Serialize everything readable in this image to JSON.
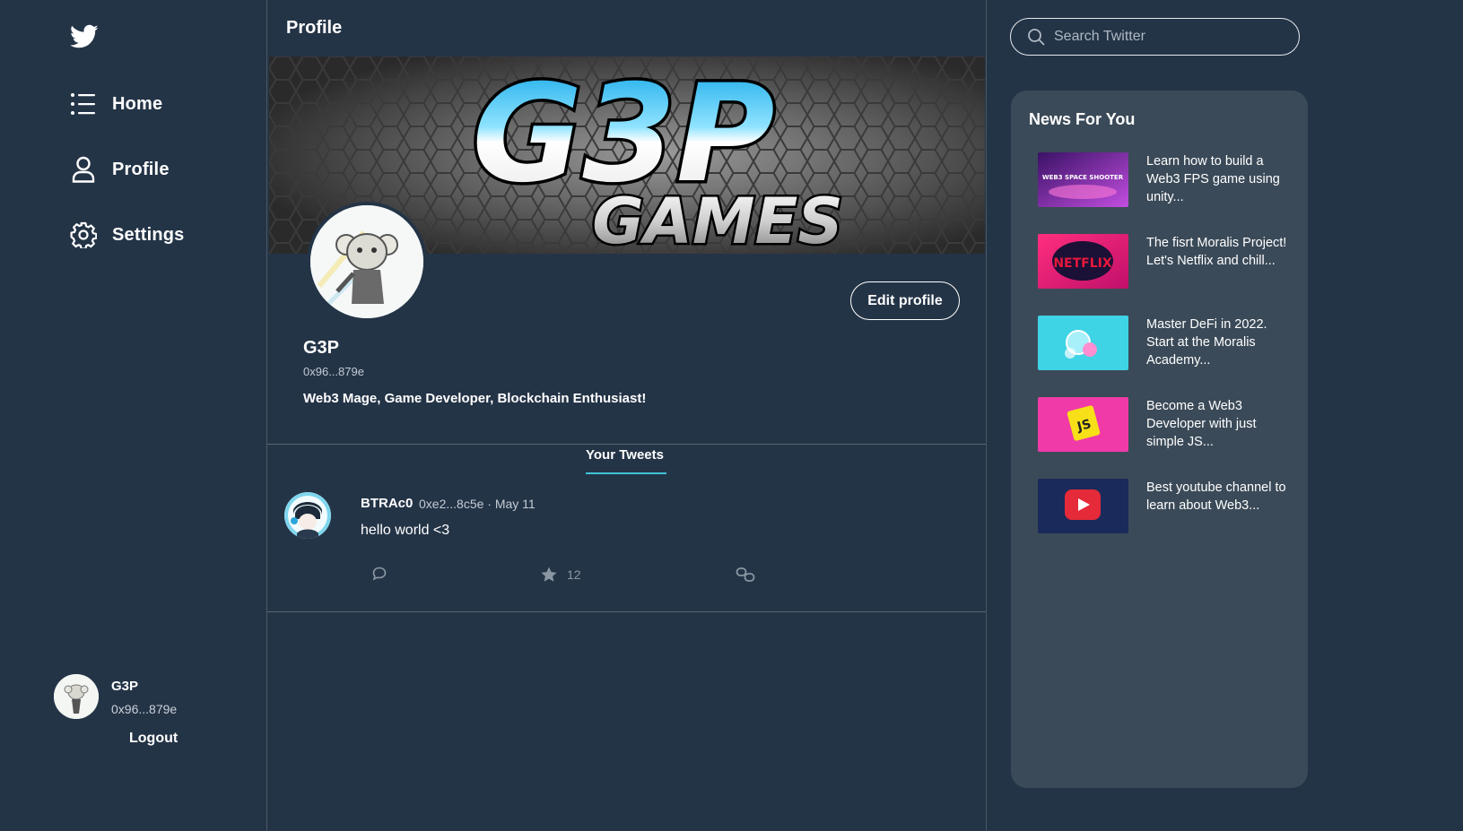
{
  "sidebar": {
    "nav": [
      {
        "label": "Home",
        "icon": "list-icon"
      },
      {
        "label": "Profile",
        "icon": "user-icon"
      },
      {
        "label": "Settings",
        "icon": "gear-icon"
      }
    ],
    "account": {
      "name": "G3P",
      "address": "0x96...879e",
      "logout": "Logout"
    }
  },
  "main": {
    "title": "Profile",
    "banner_text": {
      "top": "G3P",
      "bottom": "GAMES"
    },
    "profile": {
      "name": "G3P",
      "address": "0x96...879e",
      "bio": "Web3 Mage, Game Developer, Blockchain Enthusiast!",
      "edit_label": "Edit profile"
    },
    "tab": "Your Tweets",
    "tweet": {
      "user": "BTRAc0",
      "meta": "0xe2...8c5e · May 11",
      "text": "hello world <3",
      "likes": "12"
    }
  },
  "search": {
    "placeholder": "Search Twitter"
  },
  "news": {
    "title": "News For You",
    "items": [
      {
        "text": "Learn how to build a Web3 FPS game using unity...",
        "thumb_label": "WEB3 SPACE SHOOTER",
        "color": "#b04ad8"
      },
      {
        "text": "The fisrt Moralis Project! Let's Netflix and chill...",
        "thumb_label": "NETFLIX",
        "color": "#e0206e"
      },
      {
        "text": "Master DeFi in 2022. Start at the Moralis Academy...",
        "thumb_label": "",
        "color": "#3fd3e6"
      },
      {
        "text": "Become a Web3 Developer with just simple JS...",
        "thumb_label": "JS",
        "color": "#f03aa8"
      },
      {
        "text": "Best youtube channel to learn about Web3...",
        "thumb_label": "",
        "color": "#1a2a5a"
      }
    ]
  },
  "colors": {
    "background": "#243447",
    "accent": "#3ec2d3",
    "panel": "#3b4a58"
  }
}
